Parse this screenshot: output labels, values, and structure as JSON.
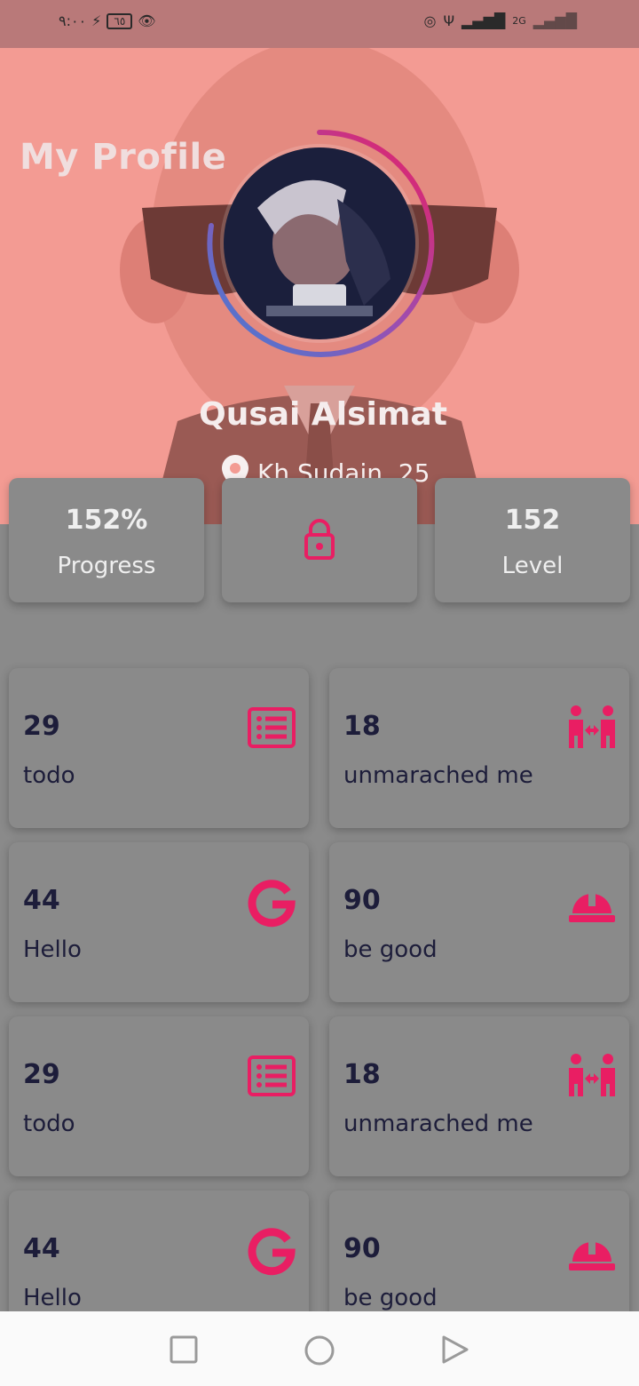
{
  "status_bar": {
    "time": "٩:٠٠",
    "battery": "٦٥",
    "network": "2G"
  },
  "profile": {
    "title": "My Profile",
    "name": "Qusai Alsimat",
    "location": "Kh Sudain ,25"
  },
  "stats": [
    {
      "value": "152%",
      "label": "Progress"
    },
    {
      "value": "",
      "label": ""
    },
    {
      "value": "152",
      "label": "Level"
    }
  ],
  "cards": [
    {
      "number": "29",
      "label": "todo",
      "icon": "list-alt-icon"
    },
    {
      "number": "18",
      "label": "unmarached me",
      "icon": "people-arrows-icon"
    },
    {
      "number": "44",
      "label": "Hello",
      "icon": "google-icon"
    },
    {
      "number": "90",
      "label": "be good",
      "icon": "hard-hat-icon"
    },
    {
      "number": "29",
      "label": "todo",
      "icon": "list-alt-icon"
    },
    {
      "number": "18",
      "label": "unmarached me",
      "icon": "people-arrows-icon"
    },
    {
      "number": "44",
      "label": "Hello",
      "icon": "google-icon"
    },
    {
      "number": "90",
      "label": "be good",
      "icon": "hard-hat-icon"
    }
  ],
  "colors": {
    "accent": "#e91e63",
    "hero_bg": "#f39b93",
    "card_bg": "#8a8a8a",
    "text_dark": "#1d1d3a"
  },
  "nav_bar": {
    "buttons": [
      "recent-apps",
      "home",
      "back"
    ]
  }
}
